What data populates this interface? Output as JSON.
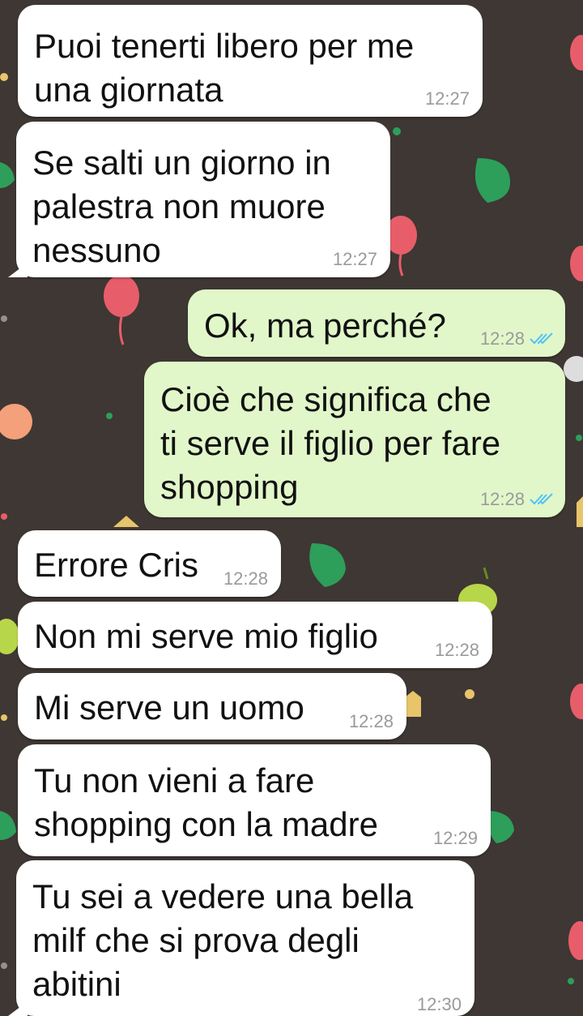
{
  "messages": [
    {
      "direction": "in",
      "text": "Puoi tenerti libero per me\nuna giornata",
      "time": "12:27"
    },
    {
      "direction": "in",
      "text": "Se salti un giorno in\npalestra non muore\nnessuno",
      "time": "12:27"
    },
    {
      "direction": "out",
      "text": "Ok, ma perché?",
      "time": "12:28",
      "status": "read"
    },
    {
      "direction": "out",
      "text": "Cioè che significa che\nti serve il figlio per fare\nshopping",
      "time": "12:28",
      "status": "read"
    },
    {
      "direction": "in",
      "text": "Errore Cris",
      "time": "12:28"
    },
    {
      "direction": "in",
      "text": "Non mi serve mio figlio",
      "time": "12:28"
    },
    {
      "direction": "in",
      "text": "Mi serve un uomo",
      "time": "12:28"
    },
    {
      "direction": "in",
      "text": "Tu non vieni a fare\nshopping con la madre",
      "time": "12:29"
    },
    {
      "direction": "in",
      "text": "Tu sei a vedere una bella\nmilf che si prova degli\nabitini",
      "time": "12:30"
    }
  ],
  "colors": {
    "wallpaper": "#3e3733",
    "incoming_bubble": "#ffffff",
    "outgoing_bubble": "#e1f7c9",
    "read_check": "#4fc3f7",
    "timestamp": "#9a9a9a"
  },
  "icons": {
    "read_status": "double-check-icon"
  }
}
